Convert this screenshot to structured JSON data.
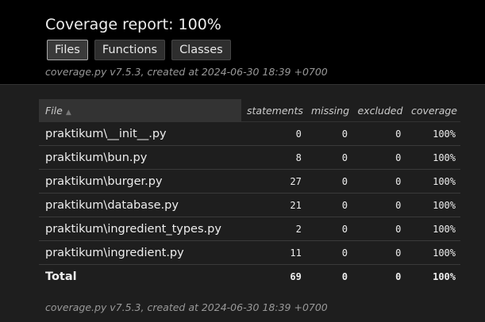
{
  "header": {
    "title": "Coverage report: 100%",
    "buttons": {
      "files": "Files",
      "functions": "Functions",
      "classes": "Classes"
    },
    "meta": "coverage.py v7.5.3, created at 2024-06-30 18:39 +0700"
  },
  "table": {
    "columns": {
      "file": "File",
      "sort_arrow": "▲",
      "statements": "statements",
      "missing": "missing",
      "excluded": "excluded",
      "coverage": "coverage"
    },
    "rows": [
      {
        "file": "praktikum\\__init__.py",
        "statements": "0",
        "missing": "0",
        "excluded": "0",
        "coverage": "100%"
      },
      {
        "file": "praktikum\\bun.py",
        "statements": "8",
        "missing": "0",
        "excluded": "0",
        "coverage": "100%"
      },
      {
        "file": "praktikum\\burger.py",
        "statements": "27",
        "missing": "0",
        "excluded": "0",
        "coverage": "100%"
      },
      {
        "file": "praktikum\\database.py",
        "statements": "21",
        "missing": "0",
        "excluded": "0",
        "coverage": "100%"
      },
      {
        "file": "praktikum\\ingredient_types.py",
        "statements": "2",
        "missing": "0",
        "excluded": "0",
        "coverage": "100%"
      },
      {
        "file": "praktikum\\ingredient.py",
        "statements": "11",
        "missing": "0",
        "excluded": "0",
        "coverage": "100%"
      }
    ],
    "total": {
      "label": "Total",
      "statements": "69",
      "missing": "0",
      "excluded": "0",
      "coverage": "100%"
    }
  },
  "footer": {
    "meta": "coverage.py v7.5.3, created at 2024-06-30 18:39 +0700"
  }
}
